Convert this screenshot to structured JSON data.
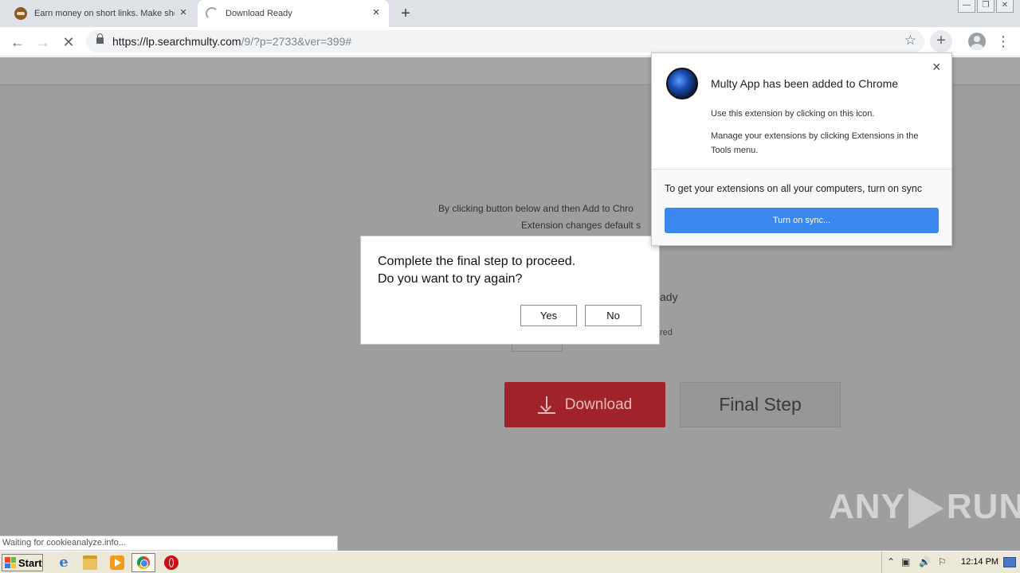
{
  "tabs": [
    {
      "title": "Earn money on short links. Make sho",
      "close": "×"
    },
    {
      "title": "Download Ready",
      "close": "×"
    }
  ],
  "new_tab": "+",
  "window_controls": {
    "minimize": "—",
    "restore": "❐",
    "close": "✕"
  },
  "toolbar": {
    "back": "←",
    "forward": "→",
    "stop": "✕",
    "url_host": "https://lp.searchmulty.com",
    "url_path": "/9/?p=2733&ver=399#",
    "star": "☆",
    "extension_plus": "+",
    "menu": "⋮"
  },
  "page": {
    "line1": "By clicking button below and then Add to Chro",
    "line2": "Extension changes default s",
    "ready_fragment": "ady",
    "small_fragment": "red",
    "download_label": "Download",
    "final_step_label": "Final Step"
  },
  "dialog": {
    "line1": "Complete the final step to proceed.",
    "line2": "Do you want to try again?",
    "yes": "Yes",
    "no": "No"
  },
  "extension_bubble": {
    "title": "Multy App has been added to Chrome",
    "close": "×",
    "text1": "Use this extension by clicking on this icon.",
    "text2": "Manage your extensions by clicking Extensions in the Tools menu.",
    "sync_text": "To get your extensions on all your computers, turn on sync",
    "sync_button": "Turn on sync..."
  },
  "watermark": {
    "left": "ANY",
    "right": "RUN"
  },
  "status_text": "Waiting for cookieanalyze.info...",
  "taskbar": {
    "start": "Start",
    "ie_glyph": "e",
    "tray_glyphs": [
      "⌃",
      "▣",
      "🔊",
      "⚐"
    ],
    "clock": "12:14 PM"
  },
  "colors": {
    "download_button": "#a0222a",
    "sync_button": "#3b87f0",
    "page_overlay": "#9e9e9e"
  }
}
